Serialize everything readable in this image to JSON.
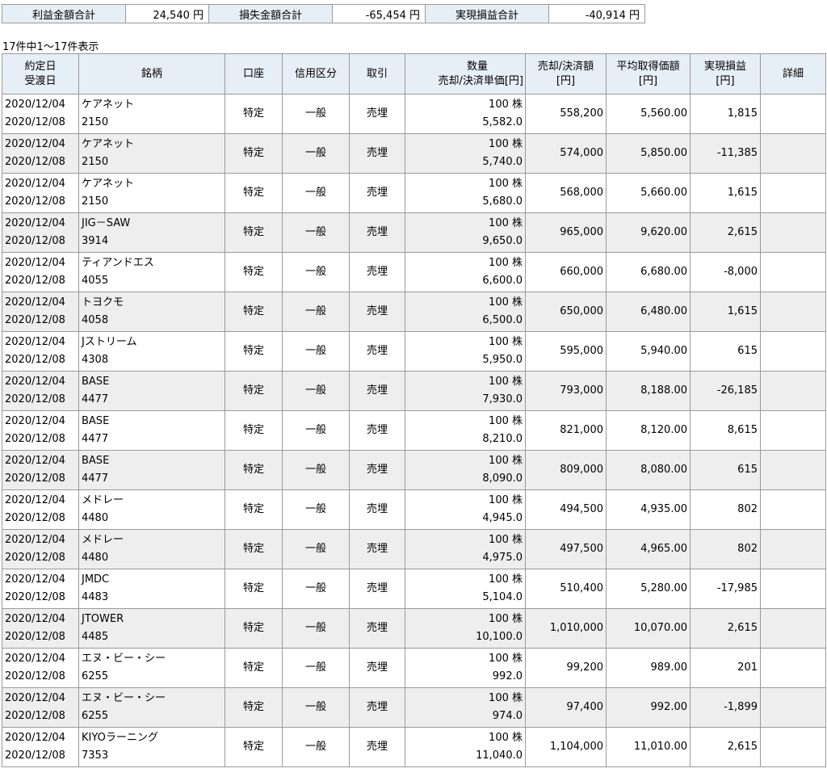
{
  "summary": {
    "profit_label": "利益金額合計",
    "profit_value": "24,540 円",
    "loss_label": "損失金額合計",
    "loss_value": "-65,454 円",
    "realized_label": "実現損益合計",
    "realized_value": "-40,914 円"
  },
  "count_text": "17件中1～17件表示",
  "headers": {
    "date1": "約定日",
    "date2": "受渡日",
    "name": "銘柄",
    "account": "口座",
    "credit": "信用区分",
    "trade": "取引",
    "qty1": "数量",
    "qty2": "売却/決済単価[円]",
    "amount1": "売却/決済額",
    "amount2": "[円]",
    "avg1": "平均取得価額",
    "avg2": "[円]",
    "pl1": "実現損益",
    "pl2": "[円]",
    "detail": "詳細"
  },
  "rows": [
    {
      "trade_date": "2020/12/04",
      "settle_date": "2020/12/08",
      "name": "ケアネット",
      "code": "2150",
      "account": "特定",
      "credit": "一般",
      "trade": "売埋",
      "qty": "100 株",
      "price": "5,582.0",
      "amount": "558,200",
      "avg": "5,560.00",
      "pl": "1,815"
    },
    {
      "trade_date": "2020/12/04",
      "settle_date": "2020/12/08",
      "name": "ケアネット",
      "code": "2150",
      "account": "特定",
      "credit": "一般",
      "trade": "売埋",
      "qty": "100 株",
      "price": "5,740.0",
      "amount": "574,000",
      "avg": "5,850.00",
      "pl": "-11,385"
    },
    {
      "trade_date": "2020/12/04",
      "settle_date": "2020/12/08",
      "name": "ケアネット",
      "code": "2150",
      "account": "特定",
      "credit": "一般",
      "trade": "売埋",
      "qty": "100 株",
      "price": "5,680.0",
      "amount": "568,000",
      "avg": "5,660.00",
      "pl": "1,615"
    },
    {
      "trade_date": "2020/12/04",
      "settle_date": "2020/12/08",
      "name": "JIG－SAW",
      "code": "3914",
      "account": "特定",
      "credit": "一般",
      "trade": "売埋",
      "qty": "100 株",
      "price": "9,650.0",
      "amount": "965,000",
      "avg": "9,620.00",
      "pl": "2,615"
    },
    {
      "trade_date": "2020/12/04",
      "settle_date": "2020/12/08",
      "name": "ティアンドエス",
      "code": "4055",
      "account": "特定",
      "credit": "一般",
      "trade": "売埋",
      "qty": "100 株",
      "price": "6,600.0",
      "amount": "660,000",
      "avg": "6,680.00",
      "pl": "-8,000"
    },
    {
      "trade_date": "2020/12/04",
      "settle_date": "2020/12/08",
      "name": "トヨクモ",
      "code": "4058",
      "account": "特定",
      "credit": "一般",
      "trade": "売埋",
      "qty": "100 株",
      "price": "6,500.0",
      "amount": "650,000",
      "avg": "6,480.00",
      "pl": "1,615"
    },
    {
      "trade_date": "2020/12/04",
      "settle_date": "2020/12/08",
      "name": "Jストリーム",
      "code": "4308",
      "account": "特定",
      "credit": "一般",
      "trade": "売埋",
      "qty": "100 株",
      "price": "5,950.0",
      "amount": "595,000",
      "avg": "5,940.00",
      "pl": "615"
    },
    {
      "trade_date": "2020/12/04",
      "settle_date": "2020/12/08",
      "name": "BASE",
      "code": "4477",
      "account": "特定",
      "credit": "一般",
      "trade": "売埋",
      "qty": "100 株",
      "price": "7,930.0",
      "amount": "793,000",
      "avg": "8,188.00",
      "pl": "-26,185"
    },
    {
      "trade_date": "2020/12/04",
      "settle_date": "2020/12/08",
      "name": "BASE",
      "code": "4477",
      "account": "特定",
      "credit": "一般",
      "trade": "売埋",
      "qty": "100 株",
      "price": "8,210.0",
      "amount": "821,000",
      "avg": "8,120.00",
      "pl": "8,615"
    },
    {
      "trade_date": "2020/12/04",
      "settle_date": "2020/12/08",
      "name": "BASE",
      "code": "4477",
      "account": "特定",
      "credit": "一般",
      "trade": "売埋",
      "qty": "100 株",
      "price": "8,090.0",
      "amount": "809,000",
      "avg": "8,080.00",
      "pl": "615"
    },
    {
      "trade_date": "2020/12/04",
      "settle_date": "2020/12/08",
      "name": "メドレー",
      "code": "4480",
      "account": "特定",
      "credit": "一般",
      "trade": "売埋",
      "qty": "100 株",
      "price": "4,945.0",
      "amount": "494,500",
      "avg": "4,935.00",
      "pl": "802"
    },
    {
      "trade_date": "2020/12/04",
      "settle_date": "2020/12/08",
      "name": "メドレー",
      "code": "4480",
      "account": "特定",
      "credit": "一般",
      "trade": "売埋",
      "qty": "100 株",
      "price": "4,975.0",
      "amount": "497,500",
      "avg": "4,965.00",
      "pl": "802"
    },
    {
      "trade_date": "2020/12/04",
      "settle_date": "2020/12/08",
      "name": "JMDC",
      "code": "4483",
      "account": "特定",
      "credit": "一般",
      "trade": "売埋",
      "qty": "100 株",
      "price": "5,104.0",
      "amount": "510,400",
      "avg": "5,280.00",
      "pl": "-17,985"
    },
    {
      "trade_date": "2020/12/04",
      "settle_date": "2020/12/08",
      "name": "JTOWER",
      "code": "4485",
      "account": "特定",
      "credit": "一般",
      "trade": "売埋",
      "qty": "100 株",
      "price": "10,100.0",
      "amount": "1,010,000",
      "avg": "10,070.00",
      "pl": "2,615"
    },
    {
      "trade_date": "2020/12/04",
      "settle_date": "2020/12/08",
      "name": "エヌ・ビー・シー",
      "code": "6255",
      "account": "特定",
      "credit": "一般",
      "trade": "売埋",
      "qty": "100 株",
      "price": "992.0",
      "amount": "99,200",
      "avg": "989.00",
      "pl": "201"
    },
    {
      "trade_date": "2020/12/04",
      "settle_date": "2020/12/08",
      "name": "エヌ・ビー・シー",
      "code": "6255",
      "account": "特定",
      "credit": "一般",
      "trade": "売埋",
      "qty": "100 株",
      "price": "974.0",
      "amount": "97,400",
      "avg": "992.00",
      "pl": "-1,899"
    },
    {
      "trade_date": "2020/12/04",
      "settle_date": "2020/12/08",
      "name": "KIYOラーニング",
      "code": "7353",
      "account": "特定",
      "credit": "一般",
      "trade": "売埋",
      "qty": "100 株",
      "price": "11,040.0",
      "amount": "1,104,000",
      "avg": "11,010.00",
      "pl": "2,615"
    }
  ]
}
